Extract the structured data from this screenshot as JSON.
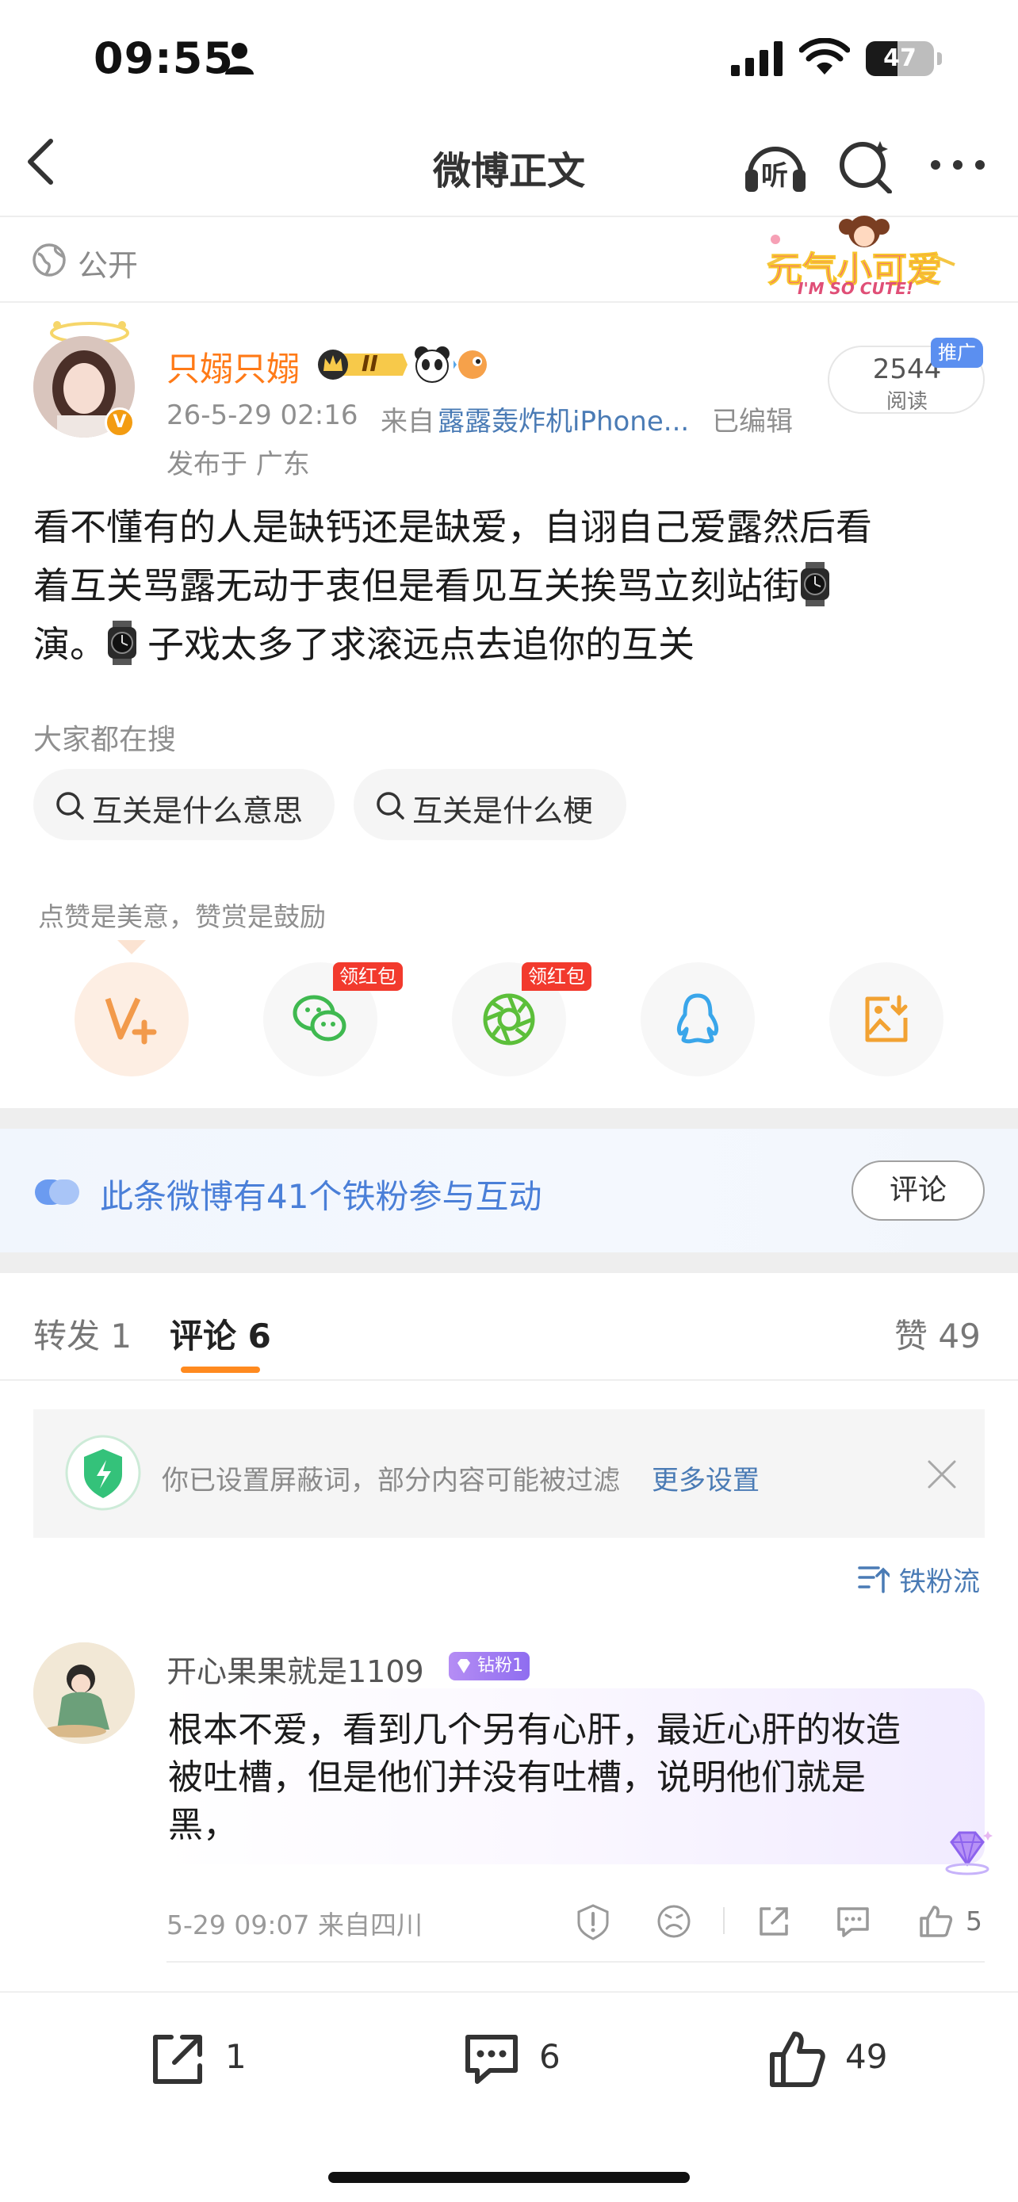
{
  "status_bar": {
    "time": "09:55",
    "battery": "47",
    "battery_level": 0.47
  },
  "nav": {
    "title": "微博正文",
    "listen_label": "听"
  },
  "post": {
    "visibility": "公开",
    "sticker_text": "元气小可爱",
    "sticker_sub": "I'M SO CUTE!",
    "author": {
      "name": "只嫋只嫋",
      "level_badge": "II"
    },
    "time": "26-5-29 02:16",
    "source_prefix": "来自",
    "device": "露露轰炸机iPhone...",
    "edited": "已编辑",
    "location": "发布于 广东",
    "reads": {
      "count": "2544",
      "label": "阅读",
      "promo": "推广"
    },
    "content_lines": [
      "看不懂有的人是缺钙还是缺爱，自诩自己爱露然后看",
      "着互关骂露无动于衷但是看见互关挨骂立刻站街",
      "演。",
      "子戏太多了求滚远点去追你的互关"
    ]
  },
  "searches": {
    "title": "大家都在搜",
    "items": [
      "互关是什么意思",
      "互关是什么梗"
    ]
  },
  "like_share": {
    "hint": "点赞是美意，赞赏是鼓励",
    "red_packet_label": "领红包"
  },
  "fans": {
    "text": "此条微博有41个铁粉参与互动",
    "comment_button": "评论"
  },
  "tabs": {
    "repost_label": "转发",
    "repost_count": "1",
    "comment_label": "评论",
    "comment_count": "6",
    "like_label": "赞",
    "like_count": "49"
  },
  "filter_notice": {
    "text": "你已设置屏蔽词，部分内容可能被过滤",
    "link": "更多设置"
  },
  "fan_flow": "铁粉流",
  "comment": {
    "name": "开心果果就是1109",
    "badge": "钻粉1",
    "lines": [
      "根本不爱，看到几个另有心肝，最近心肝的妆造",
      "被吐槽，但是他们并没有吐槽，说明他们就是",
      "黑，"
    ],
    "meta": "5-29 09:07  来自四川",
    "likes": "5"
  },
  "bottom_bar": {
    "reposts": "1",
    "comments": "6",
    "likes": "49"
  },
  "colors": {
    "orange_name": "#ff7a17",
    "link_blue": "#4a7bb5",
    "fans_blue": "#4a7fd8",
    "red_packet": "#f23a2d",
    "tab_underline": "#ff8a1f"
  }
}
